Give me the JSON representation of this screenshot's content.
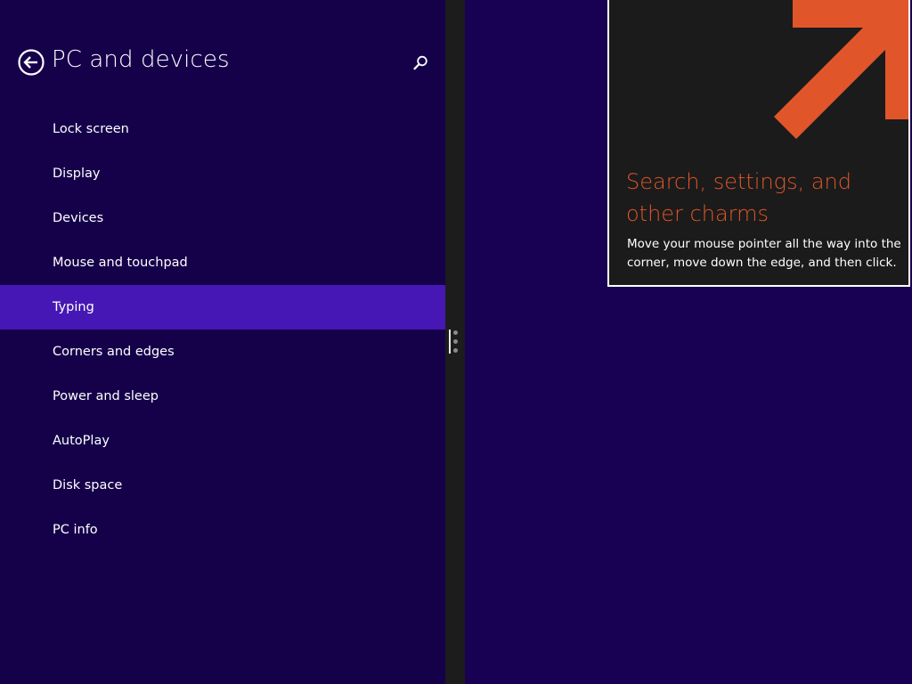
{
  "settings": {
    "title": "PC and devices",
    "back_icon": "back-arrow-circle-icon",
    "search_icon": "search-icon",
    "items": [
      {
        "label": "Lock screen",
        "selected": false
      },
      {
        "label": "Display",
        "selected": false
      },
      {
        "label": "Devices",
        "selected": false
      },
      {
        "label": "Mouse and touchpad",
        "selected": false
      },
      {
        "label": "Typing",
        "selected": true
      },
      {
        "label": "Corners and edges",
        "selected": false
      },
      {
        "label": "Power and sleep",
        "selected": false
      },
      {
        "label": "AutoPlay",
        "selected": false
      },
      {
        "label": "Disk space",
        "selected": false
      },
      {
        "label": "PC info",
        "selected": false
      }
    ]
  },
  "tip": {
    "title": "Search, settings, and other charms",
    "body": "Move your mouse pointer all the way into the corner, move down the edge, and then click.",
    "arrow_icon": "arrow-up-right-icon"
  },
  "colors": {
    "pane_background": "#15004a",
    "app_background": "#180052",
    "selected_item": "#4617b4",
    "splitter": "#1c1c1c",
    "tip_background": "#1b1b1b",
    "tip_accent": "#e0562a"
  }
}
